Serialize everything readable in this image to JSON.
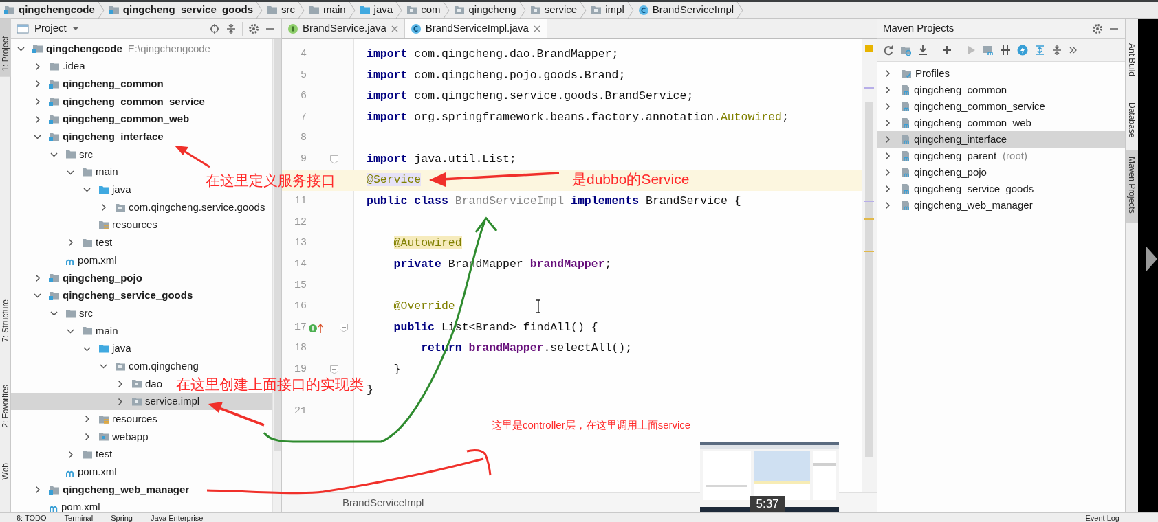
{
  "breadcrumbs": [
    {
      "label": "qingchengcode",
      "kind": "module"
    },
    {
      "label": "qingcheng_service_goods",
      "kind": "module"
    },
    {
      "label": "src",
      "kind": "folder"
    },
    {
      "label": "main",
      "kind": "folder"
    },
    {
      "label": "java",
      "kind": "source"
    },
    {
      "label": "com",
      "kind": "package"
    },
    {
      "label": "qingcheng",
      "kind": "package"
    },
    {
      "label": "service",
      "kind": "package"
    },
    {
      "label": "impl",
      "kind": "package"
    },
    {
      "label": "BrandServiceImpl",
      "kind": "class"
    }
  ],
  "left_stripe": [
    {
      "label": "1: Project",
      "selected": true
    },
    {
      "label": "7: Structure",
      "selected": false
    },
    {
      "label": "2: Favorites",
      "selected": false
    },
    {
      "label": "Web",
      "selected": false
    }
  ],
  "project_panel": {
    "title": "Project",
    "tree": [
      {
        "label": "qingchengcode",
        "kind": "module",
        "path": "E:\\qingchengcode",
        "expanded": true,
        "selected": false,
        "children": [
          {
            "label": ".idea",
            "kind": "folder",
            "expanded": false,
            "selected": false
          },
          {
            "label": "qingcheng_common",
            "kind": "module",
            "expanded": false,
            "selected": false
          },
          {
            "label": "qingcheng_common_service",
            "kind": "module",
            "expanded": false,
            "selected": false
          },
          {
            "label": "qingcheng_common_web",
            "kind": "module",
            "expanded": false,
            "selected": false
          },
          {
            "label": "qingcheng_interface",
            "kind": "module",
            "expanded": true,
            "selected": false,
            "children": [
              {
                "label": "src",
                "kind": "folder",
                "expanded": true,
                "selected": false,
                "children": [
                  {
                    "label": "main",
                    "kind": "folder",
                    "expanded": true,
                    "selected": false,
                    "children": [
                      {
                        "label": "java",
                        "kind": "source",
                        "expanded": true,
                        "selected": false,
                        "children": [
                          {
                            "label": "com.qingcheng.service.goods",
                            "kind": "package",
                            "expanded": false,
                            "selected": false
                          }
                        ]
                      },
                      {
                        "label": "resources",
                        "kind": "resources",
                        "selected": false
                      }
                    ]
                  },
                  {
                    "label": "test",
                    "kind": "folder",
                    "expanded": false,
                    "selected": false
                  }
                ]
              },
              {
                "label": "pom.xml",
                "kind": "pom",
                "selected": false
              }
            ]
          },
          {
            "label": "qingcheng_pojo",
            "kind": "module",
            "expanded": false,
            "selected": false
          },
          {
            "label": "qingcheng_service_goods",
            "kind": "module",
            "expanded": true,
            "selected": false,
            "children": [
              {
                "label": "src",
                "kind": "folder",
                "expanded": true,
                "selected": false,
                "children": [
                  {
                    "label": "main",
                    "kind": "folder",
                    "expanded": true,
                    "selected": false,
                    "children": [
                      {
                        "label": "java",
                        "kind": "source",
                        "expanded": true,
                        "selected": false,
                        "children": [
                          {
                            "label": "com.qingcheng",
                            "kind": "package",
                            "expanded": true,
                            "selected": false,
                            "children": [
                              {
                                "label": "dao",
                                "kind": "package",
                                "expanded": false,
                                "selected": false
                              },
                              {
                                "label": "service.impl",
                                "kind": "package",
                                "expanded": false,
                                "selected": true
                              }
                            ]
                          }
                        ]
                      },
                      {
                        "label": "resources",
                        "kind": "resources",
                        "expanded": false,
                        "selected": false
                      },
                      {
                        "label": "webapp",
                        "kind": "web",
                        "expanded": false,
                        "selected": false
                      }
                    ]
                  },
                  {
                    "label": "test",
                    "kind": "folder",
                    "expanded": false,
                    "selected": false
                  }
                ]
              },
              {
                "label": "pom.xml",
                "kind": "pom",
                "selected": false
              }
            ]
          },
          {
            "label": "qingcheng_web_manager",
            "kind": "module",
            "expanded": false,
            "selected": false
          },
          {
            "label": "pom.xml",
            "kind": "pom",
            "selected": false
          }
        ]
      }
    ]
  },
  "editor": {
    "tabs": [
      {
        "label": "BrandService.java",
        "kind": "interface",
        "selected": false
      },
      {
        "label": "BrandServiceImpl.java",
        "kind": "class",
        "selected": true
      }
    ],
    "lines": [
      {
        "number": "4",
        "current": false,
        "fold": false,
        "implements": false,
        "tokens": [
          {
            "text": "import",
            "kind": "keyword"
          },
          {
            "text": " com.qingcheng.dao.BrandMapper;",
            "kind": "plain"
          }
        ]
      },
      {
        "number": "5",
        "current": false,
        "fold": false,
        "implements": false,
        "tokens": [
          {
            "text": "import",
            "kind": "keyword"
          },
          {
            "text": " com.qingcheng.pojo.goods.Brand;",
            "kind": "plain"
          }
        ]
      },
      {
        "number": "6",
        "current": false,
        "fold": false,
        "implements": false,
        "tokens": [
          {
            "text": "import",
            "kind": "keyword"
          },
          {
            "text": " com.qingcheng.service.goods.BrandService;",
            "kind": "plain"
          }
        ]
      },
      {
        "number": "7",
        "current": false,
        "fold": false,
        "implements": false,
        "tokens": [
          {
            "text": "import",
            "kind": "keyword"
          },
          {
            "text": " org.springframework.beans.factory.annotation.",
            "kind": "plain"
          },
          {
            "text": "Autowired",
            "kind": "annotation"
          },
          {
            "text": ";",
            "kind": "plain"
          }
        ]
      },
      {
        "number": "8",
        "current": false,
        "fold": false,
        "implements": false
      },
      {
        "number": "9",
        "current": false,
        "fold": true,
        "implements": false,
        "tokens": [
          {
            "text": "import",
            "kind": "keyword"
          },
          {
            "text": " java.util.List;",
            "kind": "plain"
          }
        ]
      },
      {
        "current": true,
        "fold": false,
        "implements": false,
        "tokens": [
          {
            "text": "@Service",
            "kind": "annotation-marked"
          }
        ]
      },
      {
        "number": "11",
        "current": false,
        "fold": false,
        "implements": false,
        "tokens": [
          {
            "text": "public class ",
            "kind": "keyword"
          },
          {
            "text": "BrandServiceImpl ",
            "kind": "unused"
          },
          {
            "text": "implements",
            "kind": "keyword"
          },
          {
            "text": " BrandService {",
            "kind": "plain"
          }
        ]
      },
      {
        "number": "12",
        "current": false,
        "fold": false,
        "implements": false
      },
      {
        "number": "13",
        "current": false,
        "fold": false,
        "implements": false,
        "tokens": [
          {
            "text": "    @Autowired",
            "kind": "annotation-warning"
          }
        ]
      },
      {
        "number": "14",
        "current": false,
        "fold": false,
        "implements": false,
        "tokens": [
          {
            "text": "    private",
            "kind": "keyword"
          },
          {
            "text": " BrandMapper ",
            "kind": "plain"
          },
          {
            "text": "brandMapper",
            "kind": "field"
          },
          {
            "text": ";",
            "kind": "plain"
          }
        ]
      },
      {
        "number": "15",
        "current": false,
        "fold": false,
        "implements": false
      },
      {
        "number": "16",
        "current": false,
        "fold": false,
        "implements": false,
        "tokens": [
          {
            "text": "    @Override",
            "kind": "annotation"
          }
        ]
      },
      {
        "number": "17",
        "current": false,
        "fold": true,
        "implements": true,
        "tokens": [
          {
            "text": "    public",
            "kind": "keyword"
          },
          {
            "text": " List<Brand> findAll() {",
            "kind": "plain"
          }
        ]
      },
      {
        "number": "18",
        "current": false,
        "fold": false,
        "implements": false,
        "tokens": [
          {
            "text": "        return ",
            "kind": "keyword"
          },
          {
            "text": "brandMapper",
            "kind": "field"
          },
          {
            "text": ".selectAll();",
            "kind": "plain"
          }
        ]
      },
      {
        "number": "19",
        "current": false,
        "fold": true,
        "implements": false,
        "tokens": [
          {
            "text": "    }",
            "kind": "plain"
          }
        ]
      },
      {
        "current": false,
        "fold": false,
        "implements": false,
        "tokens": [
          {
            "text": "}",
            "kind": "plain"
          }
        ]
      },
      {
        "number": "21",
        "current": false,
        "fold": false,
        "implements": false
      }
    ],
    "breadcrumb": "BrandServiceImpl"
  },
  "maven_panel": {
    "title": "Maven Projects",
    "items": [
      {
        "label": "Profiles",
        "kind": "profiles",
        "selected": false
      },
      {
        "label": "qingcheng_common",
        "kind": "module",
        "selected": false
      },
      {
        "label": "qingcheng_common_service",
        "kind": "module",
        "selected": false
      },
      {
        "label": "qingcheng_common_web",
        "kind": "module",
        "selected": false
      },
      {
        "label": "qingcheng_interface",
        "kind": "module",
        "selected": true
      },
      {
        "label": "qingcheng_parent",
        "note": "(root)",
        "kind": "module",
        "selected": false
      },
      {
        "label": "qingcheng_pojo",
        "kind": "module",
        "selected": false
      },
      {
        "label": "qingcheng_service_goods",
        "kind": "module",
        "selected": false
      },
      {
        "label": "qingcheng_web_manager",
        "kind": "module",
        "selected": false
      }
    ]
  },
  "right_stripe": [
    {
      "label": "Ant Build",
      "selected": false
    },
    {
      "label": "Database",
      "selected": false
    },
    {
      "label": "Maven Projects",
      "selected": true
    }
  ],
  "bottom_bar": [
    "6: TODO",
    "Terminal",
    "Spring",
    "Java Enterprise",
    "Event Log"
  ],
  "video": {
    "time": "5:37"
  },
  "annotations": [
    "在这里定义服务接口",
    "是dubbo的Service",
    "在这里创建上面接口的实现类",
    "这里是controller层，在这里调用上面service"
  ]
}
